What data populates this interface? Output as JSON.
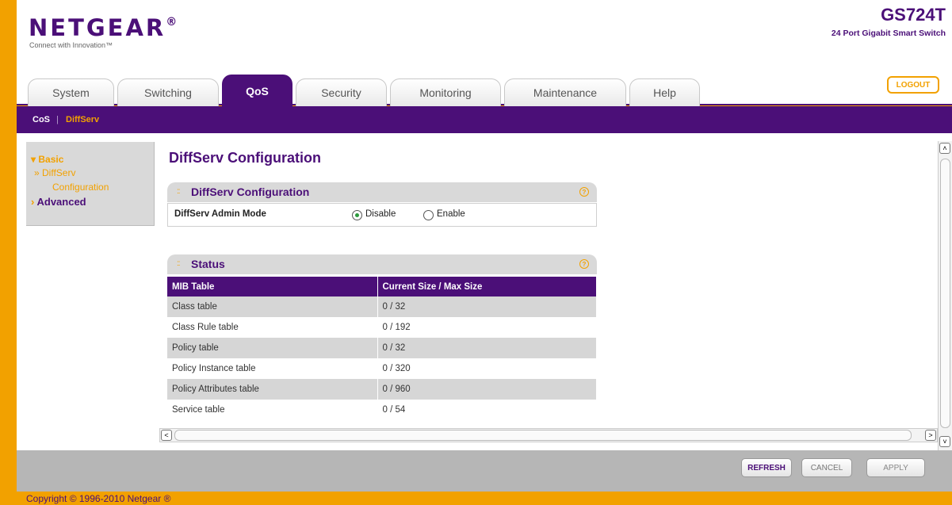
{
  "header": {
    "brand": "NETGEAR",
    "brand_mark": "®",
    "tagline": "Connect with Innovation™",
    "product_model": "GS724T",
    "product_desc": "24 Port Gigabit Smart Switch",
    "logout_label": "LOGOUT"
  },
  "tabs": [
    {
      "label": "System"
    },
    {
      "label": "Switching"
    },
    {
      "label": "QoS",
      "active": true
    },
    {
      "label": "Security"
    },
    {
      "label": "Monitoring"
    },
    {
      "label": "Maintenance"
    },
    {
      "label": "Help"
    }
  ],
  "subnav": {
    "items": [
      {
        "label": "CoS"
      },
      {
        "label": "DiffServ",
        "active": true
      }
    ],
    "separator": "|"
  },
  "sidebar": {
    "basic_label": "Basic",
    "basic_item_line1": "» DiffServ",
    "basic_item_line2": "Configuration",
    "advanced_label": "Advanced",
    "arrow_expanded": "▾",
    "arrow_collapsed": "›"
  },
  "page": {
    "title": "DiffServ Configuration"
  },
  "config_section": {
    "title": "DiffServ Configuration",
    "admin_mode_label": "DiffServ Admin Mode",
    "options": [
      {
        "label": "Disable",
        "checked": true
      },
      {
        "label": "Enable",
        "checked": false
      }
    ]
  },
  "status_section": {
    "title": "Status",
    "columns": [
      "MIB Table",
      "Current Size / Max Size"
    ],
    "rows": [
      [
        "Class table",
        "0 / 32"
      ],
      [
        "Class Rule table",
        "0 / 192"
      ],
      [
        "Policy table",
        "0 / 32"
      ],
      [
        "Policy Instance table",
        "0 / 320"
      ],
      [
        "Policy Attributes table",
        "0 / 960"
      ],
      [
        "Service table",
        "0 / 54"
      ]
    ]
  },
  "buttons": {
    "refresh": "REFRESH",
    "cancel": "CANCEL",
    "apply": "APPLY"
  },
  "footer": {
    "copyright": "Copyright © 1996-2010 Netgear ®"
  },
  "icons": {
    "help": "?",
    "grip": "::",
    "scroll_up": "˄",
    "scroll_down": "˅",
    "scroll_left": "<",
    "scroll_right": ">"
  },
  "colors": {
    "brand_purple": "#4b0f78",
    "accent_orange": "#f2a100",
    "row_gray": "#d6d6d6",
    "footer_gray": "#b6b6b6"
  }
}
